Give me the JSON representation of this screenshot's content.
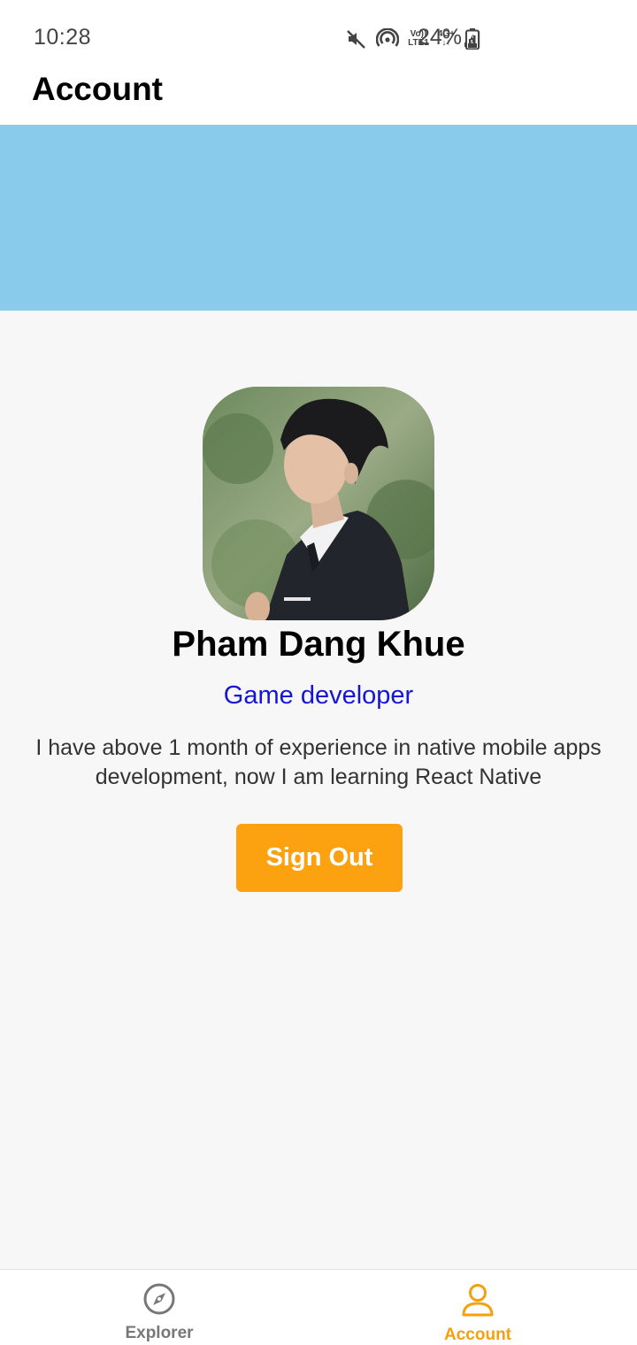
{
  "status_bar": {
    "time": "10:28",
    "net_top": "Vo))",
    "net_bottom": "LTE1",
    "net_4g": "4G+",
    "battery_pct": "24%"
  },
  "header": {
    "title": "Account"
  },
  "colors": {
    "banner": "#88cbeb",
    "accent": "#fca211",
    "role_text": "#1515d6"
  },
  "profile": {
    "name": "Pham Dang Khue",
    "role": "Game developer",
    "bio": "I have above 1 month of experience in native mobile apps development, now I am learning React Native",
    "sign_out_label": "Sign Out"
  },
  "bottom_nav": {
    "tabs": [
      {
        "label": "Explorer",
        "icon": "compass-icon",
        "active": false
      },
      {
        "label": "Account",
        "icon": "user-icon",
        "active": true
      }
    ]
  }
}
